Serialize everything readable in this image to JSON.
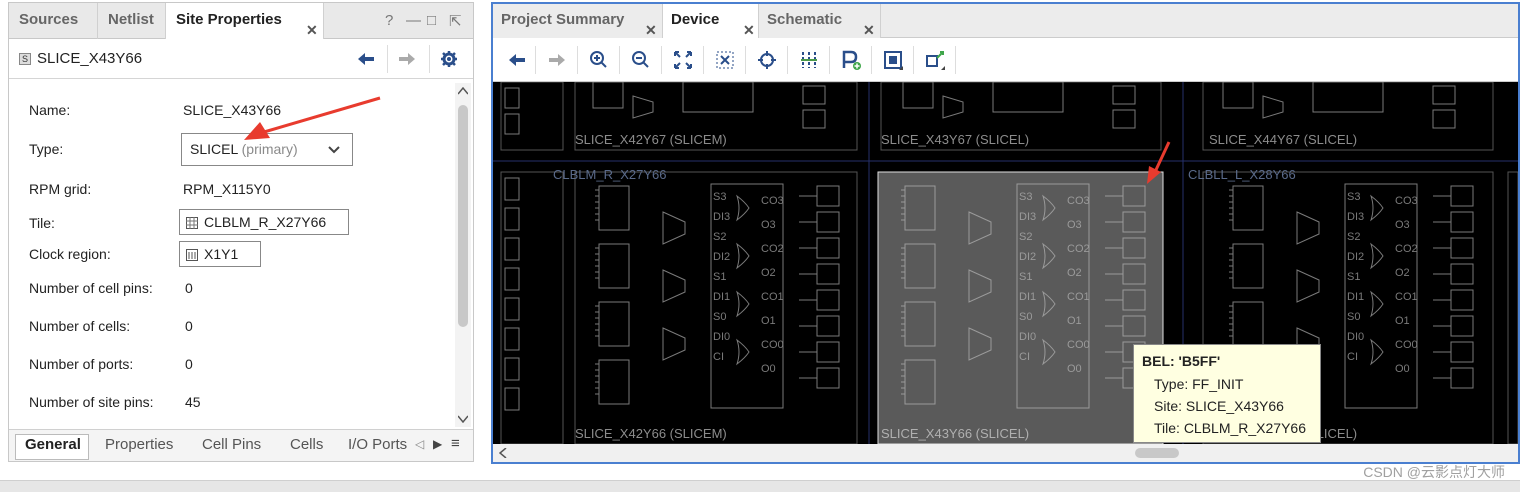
{
  "left_panel": {
    "tabs": [
      "Sources",
      "Netlist",
      "Site Properties"
    ],
    "window_icons": [
      "?",
      "—",
      "□",
      "⇱"
    ],
    "site_name": "SLICE_X43Y66",
    "site_icon_letter": "S",
    "properties": {
      "name_label": "Name:",
      "name_value": "SLICE_X43Y66",
      "type_label": "Type:",
      "type_value": "SLICEL",
      "type_suffix": "(primary)",
      "rpm_label": "RPM grid:",
      "rpm_value": "RPM_X115Y0",
      "tile_label": "Tile:",
      "tile_value": "CLBLM_R_X27Y66",
      "clock_label": "Clock region:",
      "clock_value": "X1Y1",
      "cell_pins_label": "Number of cell pins:",
      "cell_pins_value": "0",
      "cells_label": "Number of cells:",
      "cells_value": "0",
      "ports_label": "Number of ports:",
      "ports_value": "0",
      "site_pins_label": "Number of site pins:",
      "site_pins_value": "45"
    },
    "bottom_tabs": [
      "General",
      "Properties",
      "Cell Pins",
      "Cells",
      "I/O Ports"
    ]
  },
  "right_panel": {
    "tabs": [
      "Project Summary",
      "Device",
      "Schematic"
    ],
    "toolbar_icons": [
      "back-icon",
      "forward-icon",
      "zoom-in-icon",
      "zoom-out-icon",
      "zoom-fit-icon",
      "zoom-selection-icon",
      "auto-fit-icon",
      "routing-resources-icon",
      "add-pblock-icon",
      "place-icon",
      "unplace-icon"
    ],
    "canvas": {
      "slices_top": [
        "SLICE_X42Y67 (SLICEM)",
        "SLICE_X43Y67 (SLICEL)",
        "SLICE_X44Y67 (SLICEL)"
      ],
      "tiles": [
        "CLBLM_R_X27Y66",
        "CLBLL_L_X28Y66"
      ],
      "slices_bottom": [
        "SLICE_X42Y66 (SLICEM)",
        "SLICE_X43Y66 (SLICEL)",
        "SLICE_X44Y66 (SLICEL)"
      ],
      "pin_labels": [
        "S3",
        "DI3",
        "S2",
        "DI2",
        "S1",
        "DI1",
        "S0",
        "DI0",
        "CI"
      ],
      "out_labels": [
        "CO3",
        "O3",
        "CO2",
        "O2",
        "CO1",
        "O1",
        "CO0",
        "O0"
      ]
    },
    "tooltip": {
      "title": "BEL: 'B5FF'",
      "type": "Type: FF_INIT",
      "site": "Site: SLICE_X43Y66",
      "tile": "Tile: CLBLM_R_X27Y66"
    }
  },
  "watermark": "CSDN @云影点灯大师",
  "colors": {
    "accent": "#4a7fd0",
    "arrow": "#e83b2e",
    "selected_slice": "#5a5a5a",
    "tooltip_bg": "#ffffe1"
  }
}
